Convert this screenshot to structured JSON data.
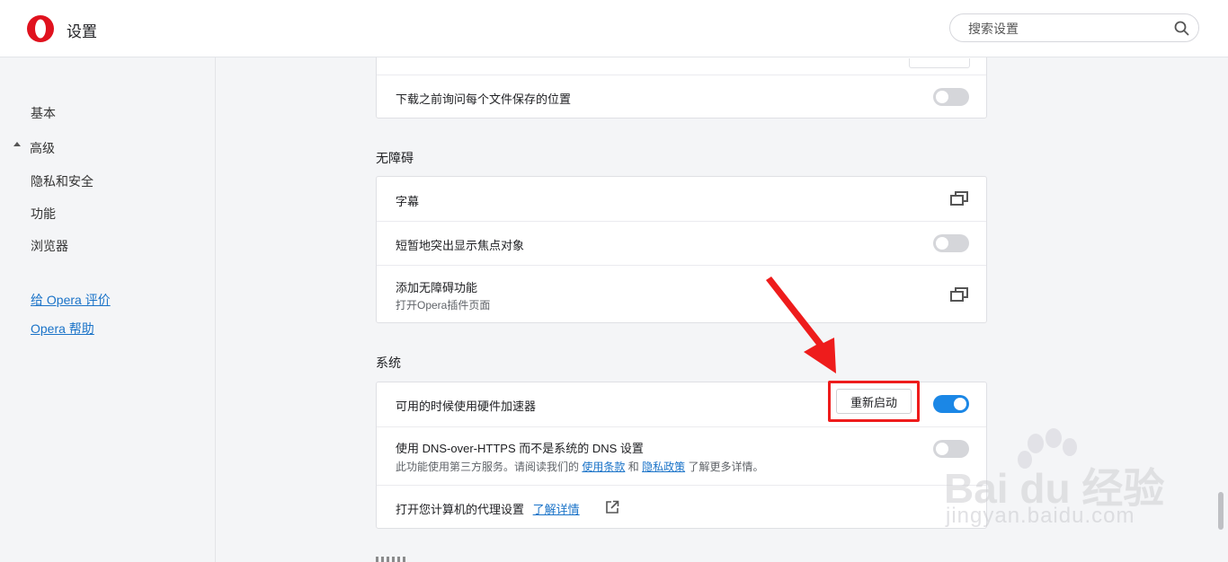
{
  "app": {
    "title": "设置"
  },
  "search": {
    "placeholder": "搜索设置"
  },
  "sidebar": {
    "items": [
      {
        "label": "基本"
      },
      {
        "label": "高级"
      },
      {
        "label": "隐私和安全"
      },
      {
        "label": "功能"
      },
      {
        "label": "浏览器"
      }
    ],
    "links": [
      {
        "label": "给 Opera 评价"
      },
      {
        "label": "Opera 帮助"
      }
    ]
  },
  "downloads": {
    "ask_location": {
      "label": "下载之前询问每个文件保存的位置",
      "enabled": false
    }
  },
  "accessibility": {
    "title": "无障碍",
    "captions": {
      "label": "字幕"
    },
    "focus_highlight": {
      "label": "短暂地突出显示焦点对象",
      "enabled": false
    },
    "add_features": {
      "label": "添加无障碍功能",
      "sub": "打开Opera插件页面"
    }
  },
  "system": {
    "title": "系统",
    "hw_accel": {
      "label": "可用的时候使用硬件加速器",
      "button": "重新启动",
      "enabled": true
    },
    "doh": {
      "label": "使用 DNS-over-HTTPS 而不是系统的 DNS 设置",
      "sub_prefix": "此功能使用第三方服务。请阅读我们的",
      "terms_link": "使用条款",
      "and": "和",
      "privacy_link": "隐私政策",
      "sub_suffix": "了解更多详情。",
      "enabled": false
    },
    "proxy": {
      "label": "打开您计算机的代理设置",
      "link": "了解详情"
    }
  },
  "watermark": {
    "brand": "Bai du 经验",
    "url": "jingyan.baidu.com"
  },
  "colors": {
    "accent": "#1b87e6",
    "highlight": "#ee1c1c",
    "link": "#1a73c8"
  }
}
